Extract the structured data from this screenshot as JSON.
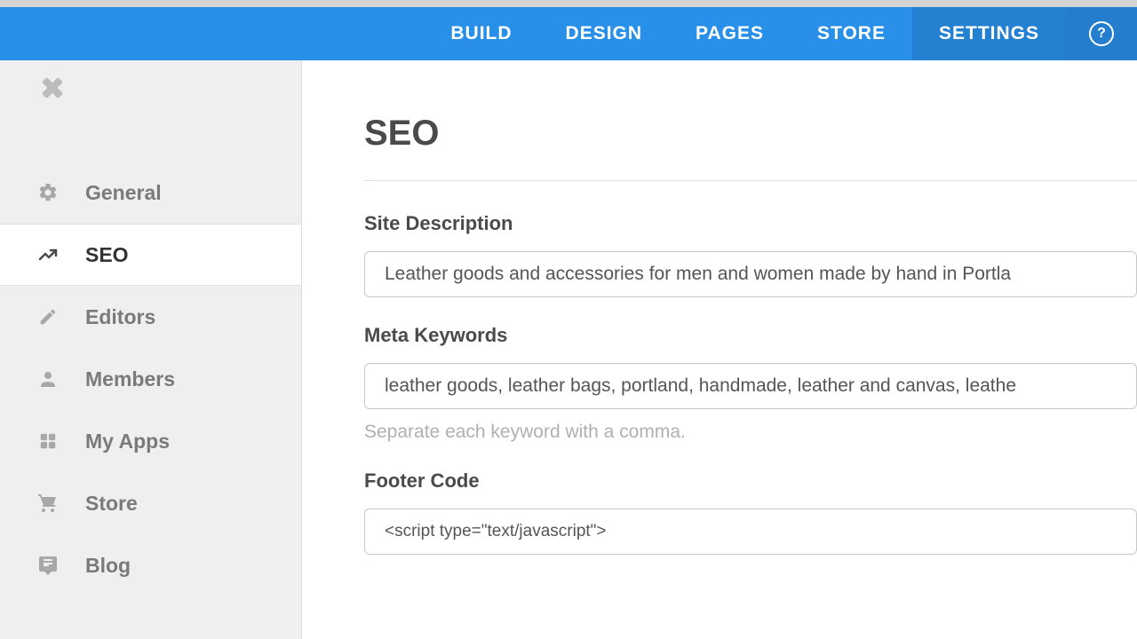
{
  "topnav": {
    "items": [
      {
        "label": "BUILD",
        "active": false
      },
      {
        "label": "DESIGN",
        "active": false
      },
      {
        "label": "PAGES",
        "active": false
      },
      {
        "label": "STORE",
        "active": false
      },
      {
        "label": "SETTINGS",
        "active": true
      }
    ]
  },
  "help": {
    "char": "?"
  },
  "sidebar": {
    "items": [
      {
        "label": "General",
        "icon": "gear",
        "active": false
      },
      {
        "label": "SEO",
        "icon": "trend",
        "active": true
      },
      {
        "label": "Editors",
        "icon": "pencil",
        "active": false
      },
      {
        "label": "Members",
        "icon": "person",
        "active": false
      },
      {
        "label": "My Apps",
        "icon": "grid",
        "active": false
      },
      {
        "label": "Store",
        "icon": "cart",
        "active": false
      },
      {
        "label": "Blog",
        "icon": "chat",
        "active": false
      }
    ]
  },
  "page": {
    "title": "SEO",
    "site_description": {
      "label": "Site Description",
      "value": "Leather goods and accessories for men and women made by hand in Portla"
    },
    "meta_keywords": {
      "label": "Meta Keywords",
      "value": "leather goods, leather bags, portland, handmade, leather and canvas, leathe",
      "helper": "Separate each keyword with a comma."
    },
    "footer_code": {
      "label": "Footer Code",
      "value": "<script type=\"text/javascript\">"
    }
  }
}
